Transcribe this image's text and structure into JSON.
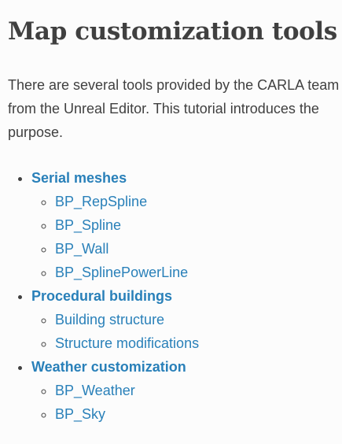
{
  "page": {
    "title": "Map customization tools",
    "intro": [
      "There are several tools provided by the CARLA team",
      "from the Unreal Editor. This tutorial introduces the",
      "purpose."
    ]
  },
  "toc": [
    {
      "label": "Serial meshes",
      "children": [
        "BP_RepSpline",
        "BP_Spline",
        "BP_Wall",
        "BP_SplinePowerLine"
      ]
    },
    {
      "label": "Procedural buildings",
      "children": [
        "Building structure",
        "Structure modifications"
      ]
    },
    {
      "label": "Weather customization",
      "children": [
        "BP_Weather",
        "BP_Sky"
      ]
    }
  ],
  "colors": {
    "link": "#2980b9",
    "text": "#404040",
    "background": "#fcfcfc"
  }
}
